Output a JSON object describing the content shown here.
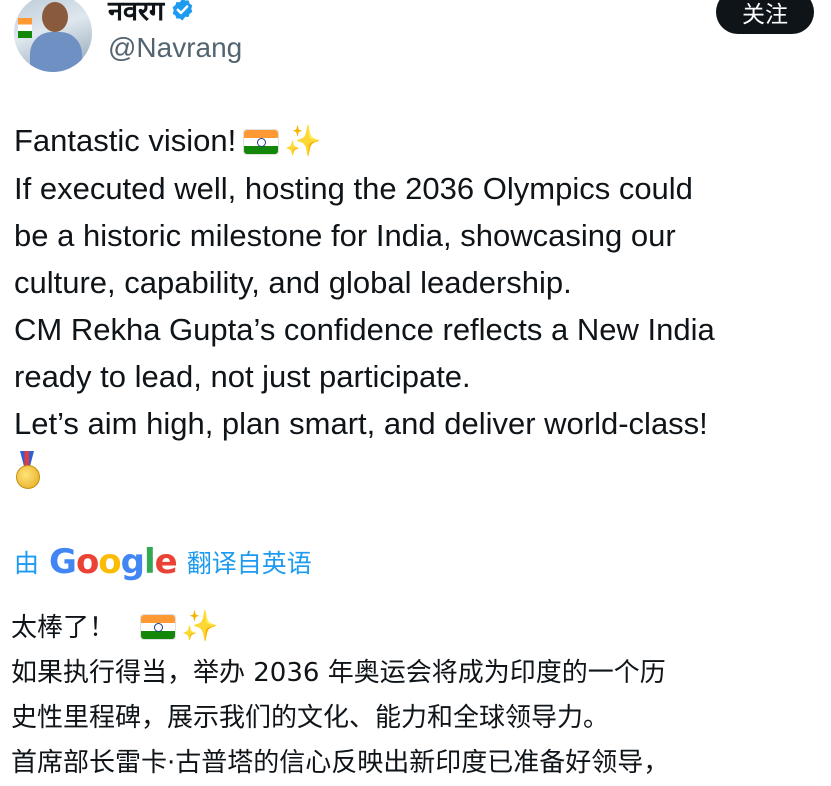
{
  "author": {
    "display_name": "नवरग",
    "handle": "@Navrang",
    "verified": true
  },
  "follow_button": {
    "label": "关注"
  },
  "post": {
    "lines": [
      "Fantastic vision!",
      "If executed well, hosting the 2036 Olympics could",
      "be a historic milestone for India, showcasing our",
      "culture, capability, and global leadership.",
      "CM Rekha Gupta’s confidence reflects a New India",
      "ready to lead, not just participate.",
      "Let’s aim high, plan smart, and deliver world-class!"
    ],
    "emojis": [
      "flag-india",
      "sparkles",
      "gold-medal"
    ]
  },
  "translation": {
    "prefix": "由",
    "provider": "Google",
    "suffix": "翻译自英语",
    "lines": [
      "太棒了！",
      "如果执行得当，举办 2036 年奥运会将成为印度的一个历",
      "史性里程碑，展示我们的文化、能力和全球领导力。",
      "首席部长雷卡·古普塔的信心反映出新印度已准备好领导，"
    ]
  },
  "colors": {
    "text": "#0f1419",
    "secondary": "#536471",
    "link": "#1d9bf0",
    "button_bg": "#0f1419",
    "verified_badge": "#1d9bf0"
  }
}
